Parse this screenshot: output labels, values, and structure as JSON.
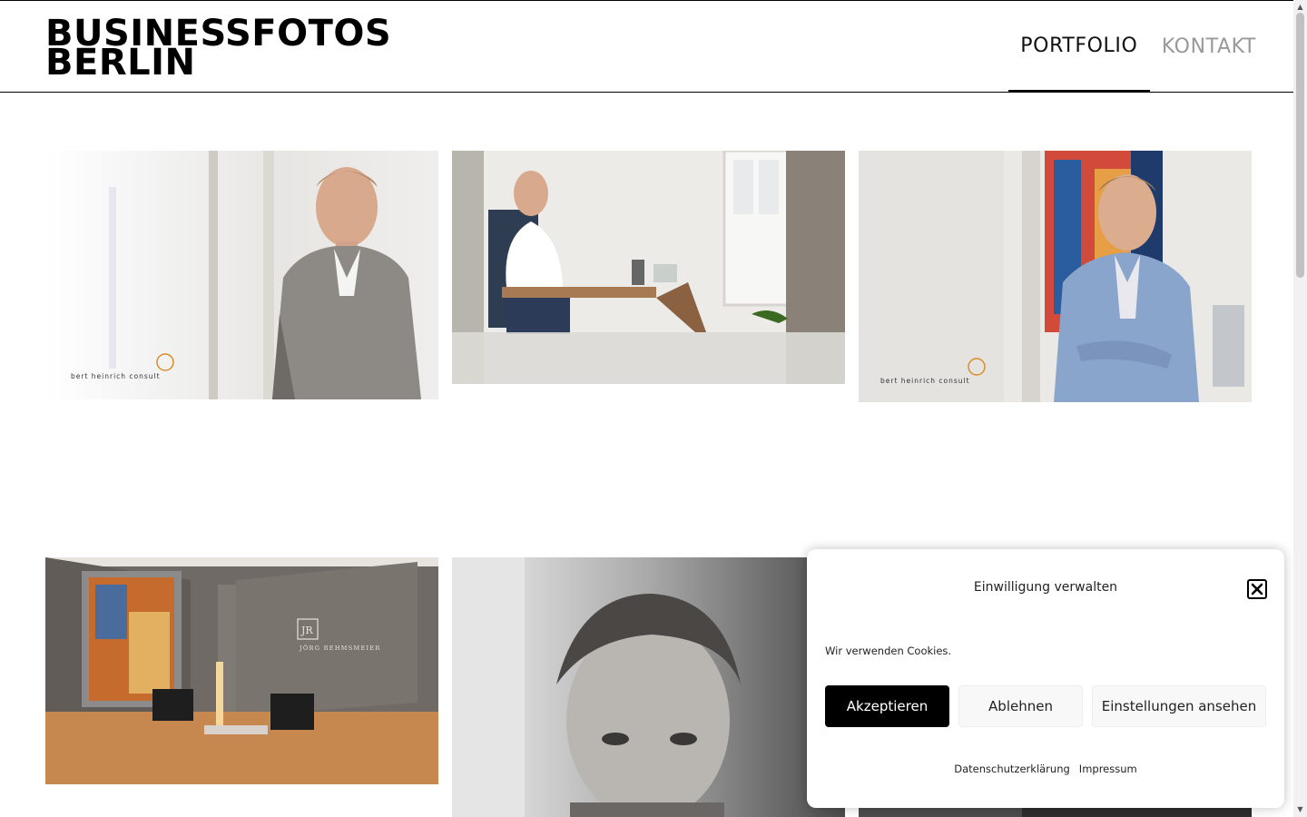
{
  "header": {
    "logo_line1": "BUSINESSFOTOS",
    "logo_line2": "BERLIN",
    "nav": [
      {
        "label": "PORTFOLIO",
        "active": true
      },
      {
        "label": "KONTAKT",
        "active": false
      }
    ]
  },
  "gallery": {
    "images": [
      {
        "subject": "businessman-standing-portrait",
        "watermark": "bert heinrich consult"
      },
      {
        "subject": "businessman-at-desk"
      },
      {
        "subject": "businessman-blue-jacket-portrait",
        "watermark": "bert heinrich consult"
      },
      {
        "subject": "office-lobby-interior",
        "sign_monogram": "JR",
        "sign_name": "JÖRG REHMSMEIER"
      },
      {
        "subject": "black-white-headshot"
      },
      {
        "subject": "partial-image"
      }
    ]
  },
  "cookie": {
    "title": "Einwilligung verwalten",
    "text": "Wir verwenden Cookies.",
    "accept_label": "Akzeptieren",
    "deny_label": "Ablehnen",
    "settings_label": "Einstellungen ansehen",
    "privacy_label": "Datenschutzerklärung",
    "imprint_label": "Impressum"
  },
  "colors": {
    "accent": "#000000",
    "nav_inactive": "#999999",
    "watermark_orange": "#d98c2b"
  }
}
